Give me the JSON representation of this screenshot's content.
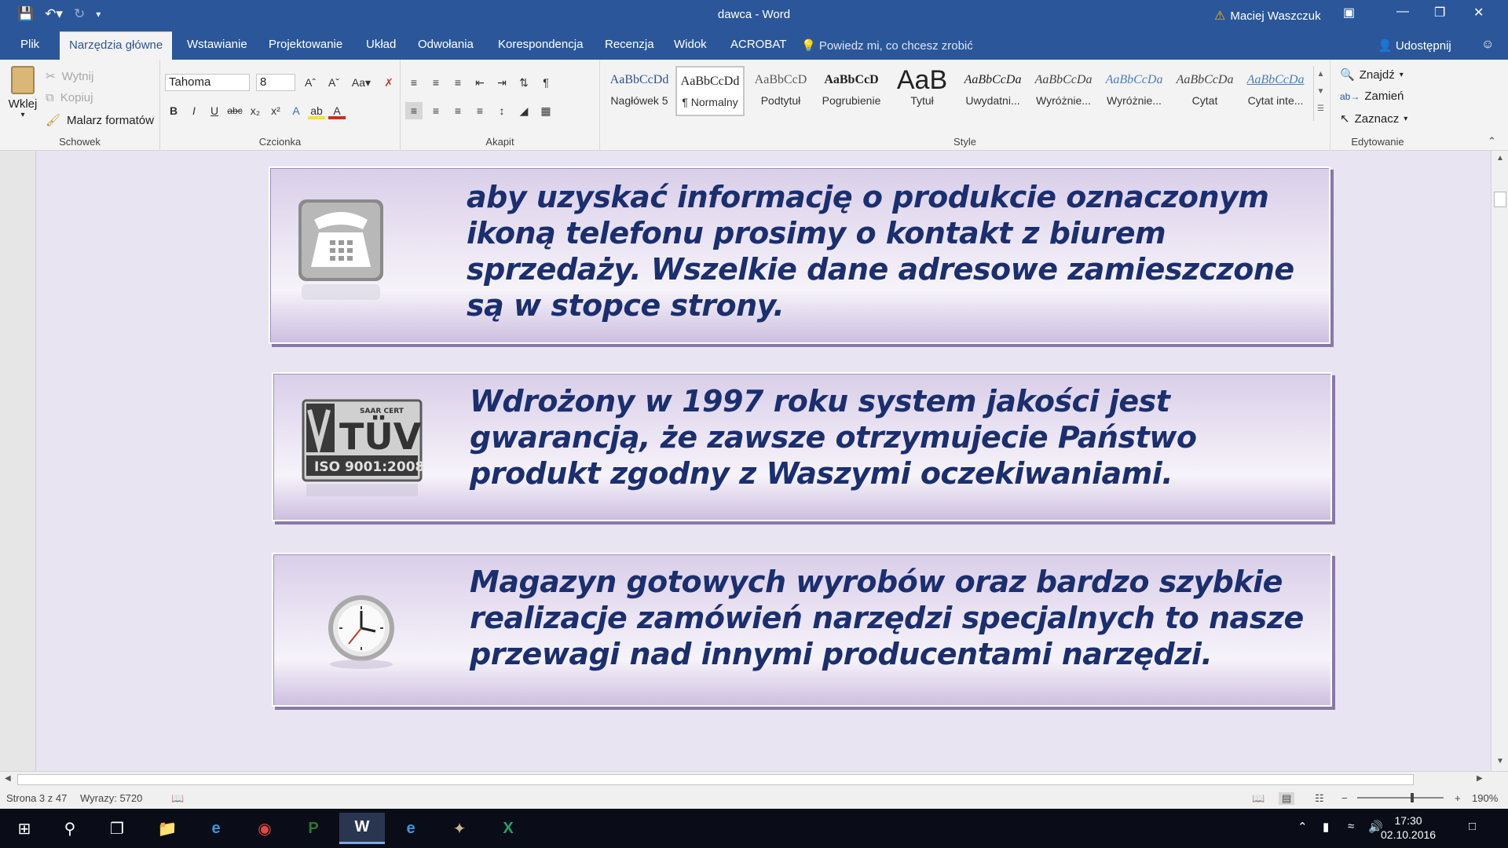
{
  "window": {
    "title": "dawca - Word",
    "user": "Maciej Waszczuk"
  },
  "tabs": [
    "Plik",
    "Narzędzia główne",
    "Wstawianie",
    "Projektowanie",
    "Układ",
    "Odwołania",
    "Korespondencja",
    "Recenzja",
    "Widok",
    "ACROBAT"
  ],
  "tell_me": "Powiedz mi, co chcesz zrobić",
  "share": "Udostępnij",
  "ribbon": {
    "clipboard": {
      "paste": "Wklej",
      "cut": "Wytnij",
      "copy": "Kopiuj",
      "format_painter": "Malarz formatów",
      "label": "Schowek"
    },
    "font": {
      "name": "Tahoma",
      "size": "8",
      "label": "Czcionka"
    },
    "paragraph": {
      "label": "Akapit"
    },
    "styles": {
      "label": "Style",
      "items": [
        {
          "preview": "AaBbCcDd",
          "name": "Nagłówek 5",
          "color": "#2e5395"
        },
        {
          "preview": "AaBbCcDd",
          "name": "¶ Normalny",
          "color": "#222222"
        },
        {
          "preview": "AaBbCcD",
          "name": "Podtytuł",
          "color": "#5a5a5a"
        },
        {
          "preview": "AaBbCcD",
          "name": "Pogrubienie",
          "color": "#222222"
        },
        {
          "preview": "AaB",
          "name": "Tytuł",
          "color": "#222222"
        },
        {
          "preview": "AaBbCcDa",
          "name": "Uwydatni...",
          "color": "#333333"
        },
        {
          "preview": "AaBbCcDa",
          "name": "Wyróżnie...",
          "color": "#444444"
        },
        {
          "preview": "AaBbCcDa",
          "name": "Wyróżnie...",
          "color": "#4a7cc0"
        },
        {
          "preview": "AaBbCcDa",
          "name": "Cytat",
          "color": "#444444"
        },
        {
          "preview": "AaBbCcDa",
          "name": "Cytat inte...",
          "color": "#4a7cc0"
        }
      ]
    },
    "editing": {
      "find": "Znajdź",
      "replace": "Zamień",
      "select": "Zaznacz",
      "label": "Edytowanie"
    }
  },
  "document": {
    "panels": [
      {
        "icon": "telephone-icon",
        "text": "aby uzyskać informację o produkcie oznaczonym ikoną telefonu prosimy o kontakt z biurem sprzedaży. Wszelkie dane adresowe zamieszczone są w stopce strony."
      },
      {
        "icon": "tuv-iso-certificate-icon",
        "text": "Wdrożony w 1997 roku system jakości jest gwarancją, że zawsze otrzymujecie Państwo produkt zgodny z Waszymi oczekiwaniami.",
        "logo_text": [
          "SAAR CERT",
          "TÜV",
          "ISO 9001:2008"
        ]
      },
      {
        "icon": "clock-icon",
        "text": "Magazyn gotowych wyrobów oraz bardzo szybkie realizacje zamówień narzędzi specjalnych to nasze przewagi nad innymi producentami narzędzi."
      }
    ]
  },
  "status": {
    "page": "Strona 3 z 47",
    "words": "Wyrazy: 5720",
    "zoom": "190%"
  },
  "taskbar": {
    "time": "17:30",
    "date": "02.10.2016"
  }
}
